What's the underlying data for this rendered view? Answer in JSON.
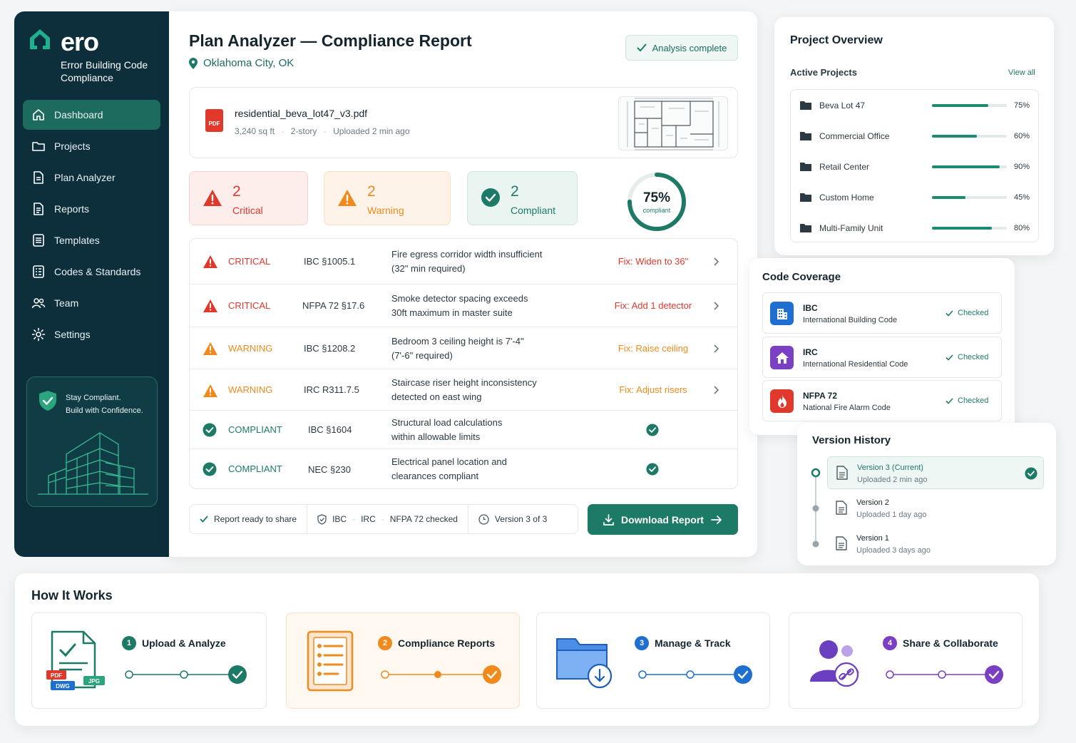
{
  "brand": {
    "name": "ero",
    "subtitle": "Error Building Code Compliance",
    "color": "#1d8a72"
  },
  "sidebar": {
    "items": [
      {
        "label": "Dashboard",
        "icon": "home-icon",
        "active": true
      },
      {
        "label": "Projects",
        "icon": "folder-icon"
      },
      {
        "label": "Plan Analyzer",
        "icon": "document-icon"
      },
      {
        "label": "Reports",
        "icon": "report-icon"
      },
      {
        "label": "Templates",
        "icon": "template-icon"
      },
      {
        "label": "Codes & Standards",
        "icon": "codes-icon"
      },
      {
        "label": "Team",
        "icon": "team-icon"
      },
      {
        "label": "Settings",
        "icon": "gear-icon"
      }
    ],
    "promo": {
      "line1": "Stay Compliant.",
      "line2": "Build with Confidence."
    }
  },
  "report": {
    "title": "Plan Analyzer — Compliance Report",
    "location": "Oklahoma City, OK",
    "status": "Analysis complete",
    "file": {
      "name": "residential_beva_lot47_v3.pdf",
      "badge": "PDF",
      "area": "3,240 sq ft",
      "stories": "2-story",
      "uploaded": "Uploaded 2 min ago"
    },
    "stats": {
      "critical": {
        "count": "2",
        "label": "Critical"
      },
      "warning": {
        "count": "2",
        "label": "Warning"
      },
      "compliant": {
        "count": "2",
        "label": "Compliant"
      },
      "score": {
        "value": "75%",
        "label": "compliant",
        "fraction": 0.75
      }
    },
    "issues": [
      {
        "severity": "CRITICAL",
        "code": "IBC §1005.1",
        "desc1": "Fire egress corridor width insufficient",
        "desc2": "(32\" min required)",
        "fix": "Fix: Widen to 36\""
      },
      {
        "severity": "CRITICAL",
        "code": "NFPA 72 §17.6",
        "desc1": "Smoke detector spacing exceeds",
        "desc2": "30ft maximum in master suite",
        "fix": "Fix: Add 1 detector"
      },
      {
        "severity": "WARNING",
        "code": "IBC §1208.2",
        "desc1": "Bedroom 3 ceiling height is 7'-4\"",
        "desc2": "(7'-6\" required)",
        "fix": "Fix: Raise ceiling"
      },
      {
        "severity": "WARNING",
        "code": "IRC R311.7.5",
        "desc1": "Staircase riser height inconsistency",
        "desc2": "detected on east wing",
        "fix": "Fix: Adjust risers"
      },
      {
        "severity": "COMPLIANT",
        "code": "IBC §1604",
        "desc1": "Structural load calculations",
        "desc2": "within allowable limits",
        "fix": ""
      },
      {
        "severity": "COMPLIANT",
        "code": "NEC §230",
        "desc1": "Electrical panel location and",
        "desc2": "clearances compliant",
        "fix": ""
      }
    ],
    "footer": {
      "ready": "Report ready to share",
      "codes_a": "IBC",
      "codes_b": "IRC",
      "codes_c": "NFPA 72 checked",
      "version": "Version 3 of 3",
      "download": "Download Report"
    }
  },
  "overview": {
    "title": "Project Overview",
    "subtitle": "Active Projects",
    "view_all": "View all",
    "projects": [
      {
        "name": "Beva Lot 47",
        "progress": 0.75,
        "pct": "75%"
      },
      {
        "name": "Commercial Office",
        "progress": 0.6,
        "pct": "60%"
      },
      {
        "name": "Retail Center",
        "progress": 0.9,
        "pct": "90%"
      },
      {
        "name": "Custom Home",
        "progress": 0.45,
        "pct": "45%"
      },
      {
        "name": "Multi-Family Unit",
        "progress": 0.8,
        "pct": "80%"
      }
    ]
  },
  "coverage": {
    "title": "Code Coverage",
    "items": [
      {
        "code": "IBC",
        "name": "International Building Code",
        "status": "Checked",
        "color": "#1f6fd1",
        "icon": "building-icon"
      },
      {
        "code": "IRC",
        "name": "International Residential Code",
        "status": "Checked",
        "color": "#7b3fc4",
        "icon": "house-icon"
      },
      {
        "code": "NFPA 72",
        "name": "National Fire Alarm Code",
        "status": "Checked",
        "color": "#e0392b",
        "icon": "flame-icon"
      }
    ]
  },
  "versions": {
    "title": "Version History",
    "items": [
      {
        "name": "Version 3 (Current)",
        "date": "Uploaded 2 min ago",
        "current": true
      },
      {
        "name": "Version 2",
        "date": "Uploaded 1 day ago"
      },
      {
        "name": "Version 1",
        "date": "Uploaded 3 days ago"
      }
    ]
  },
  "how": {
    "title": "How It Works",
    "steps": [
      {
        "num": "1",
        "label": "Upload & Analyze",
        "color": "#1d7a66",
        "tags": [
          "PDF",
          "JPG",
          "DWG"
        ]
      },
      {
        "num": "2",
        "label": "Compliance Reports",
        "color": "#f08a1c"
      },
      {
        "num": "3",
        "label": "Manage & Track",
        "color": "#1f6fd1"
      },
      {
        "num": "4",
        "label": "Share & Collaborate",
        "color": "#7b3fc4"
      }
    ]
  },
  "colors": {
    "critical": "#e0392b",
    "warning": "#f08a1c",
    "compliant": "#1d7a66",
    "sidebar": "#0d2f3c"
  }
}
